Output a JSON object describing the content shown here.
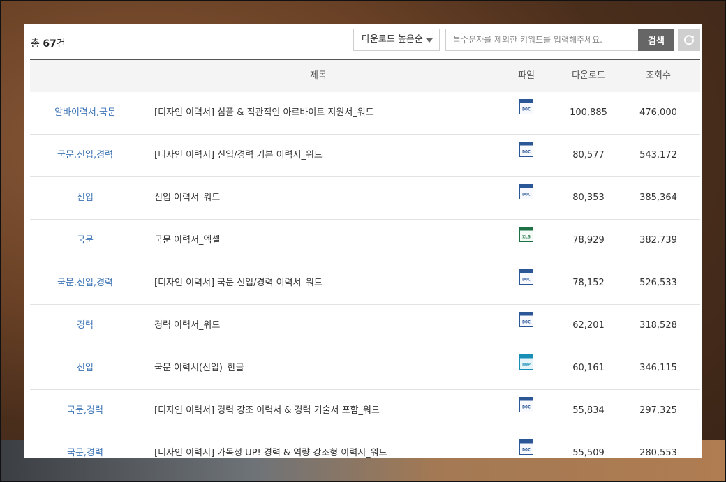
{
  "toolbar": {
    "total_prefix": "총 ",
    "total_count": "67",
    "total_suffix": "건",
    "sort_label": "다운로드 높은순",
    "search_placeholder": "특수문자를 제외한 키워드를 입력해주세요.",
    "search_value": "",
    "search_button": "검색"
  },
  "table": {
    "headers": {
      "category": "",
      "title": "제목",
      "file": "파일",
      "downloads": "다운로드",
      "views": "조회수"
    },
    "rows": [
      {
        "category": "알바이력서,국문",
        "title": "[디자인 이력서] 심플 & 직관적인 아르바이트 지원서_워드",
        "file_type": "DOC",
        "downloads": "100,885",
        "views": "476,000"
      },
      {
        "category": "국문,신입,경력",
        "title": "[디자인 이력서] 신입/경력 기본 이력서_워드",
        "file_type": "DOC",
        "downloads": "80,577",
        "views": "543,172"
      },
      {
        "category": "신입",
        "title": "신입 이력서_워드",
        "file_type": "DOC",
        "downloads": "80,353",
        "views": "385,364"
      },
      {
        "category": "국문",
        "title": "국문 이력서_엑셀",
        "file_type": "XLS",
        "downloads": "78,929",
        "views": "382,739"
      },
      {
        "category": "국문,신입,경력",
        "title": "[디자인 이력서] 국문 신입/경력 이력서_워드",
        "file_type": "DOC",
        "downloads": "78,152",
        "views": "526,533"
      },
      {
        "category": "경력",
        "title": "경력 이력서_워드",
        "file_type": "DOC",
        "downloads": "62,201",
        "views": "318,528"
      },
      {
        "category": "신입",
        "title": "국문 이력서(신입)_한글",
        "file_type": "HWP",
        "downloads": "60,161",
        "views": "346,115"
      },
      {
        "category": "국문,경력",
        "title": "[디자인 이력서] 경력 강조 이력서 & 경력 기술서 포함_워드",
        "file_type": "DOC",
        "downloads": "55,834",
        "views": "297,325"
      },
      {
        "category": "국문,경력",
        "title": "[디자인 이력서] 가독성 UP! 경력 & 역량 강조형 이력서_워드",
        "file_type": "DOC",
        "downloads": "55,509",
        "views": "280,553"
      }
    ]
  },
  "icons": {
    "DOC": {
      "name": "doc-file-icon",
      "color": "#2b5797"
    },
    "XLS": {
      "name": "xls-file-icon",
      "color": "#1e7145"
    },
    "HWP": {
      "name": "hwp-file-icon",
      "color": "#1a8fb5"
    },
    "refresh": "refresh-icon",
    "sort_caret": "chevron-down-icon"
  }
}
